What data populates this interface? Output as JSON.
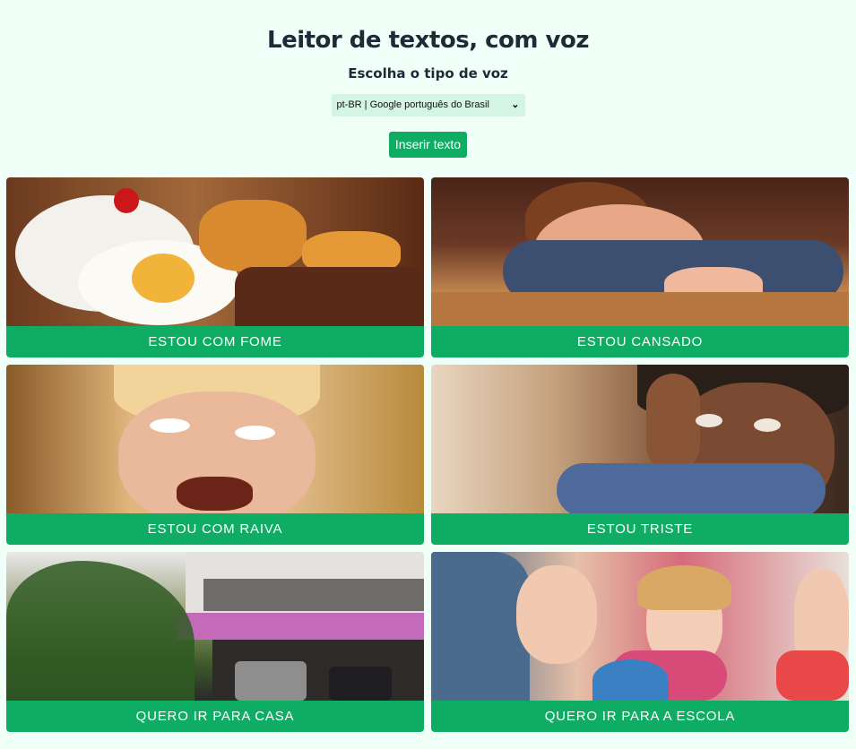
{
  "header": {
    "title": "Leitor de textos, com voz",
    "subtitle": "Escolha o tipo de voz",
    "voice_selected": "pt-BR | Google português do Brasil",
    "insert_button": "Inserir texto"
  },
  "cards": [
    {
      "label": "ESTOU COM FOME",
      "image": "food-plate-photo"
    },
    {
      "label": "ESTOU CANSADO",
      "image": "tired-boy-photo"
    },
    {
      "label": "ESTOU COM RAIVA",
      "image": "angry-boy-photo"
    },
    {
      "label": "ESTOU TRISTE",
      "image": "sad-boy-photo"
    },
    {
      "label": "QUERO IR PARA CASA",
      "image": "house-photo"
    },
    {
      "label": "QUERO IR PARA A ESCOLA",
      "image": "school-children-photo"
    }
  ],
  "colors": {
    "background": "#f0fff8",
    "accent": "#0fad63",
    "select_bg": "#d4f5e4",
    "text": "#1f2937"
  }
}
